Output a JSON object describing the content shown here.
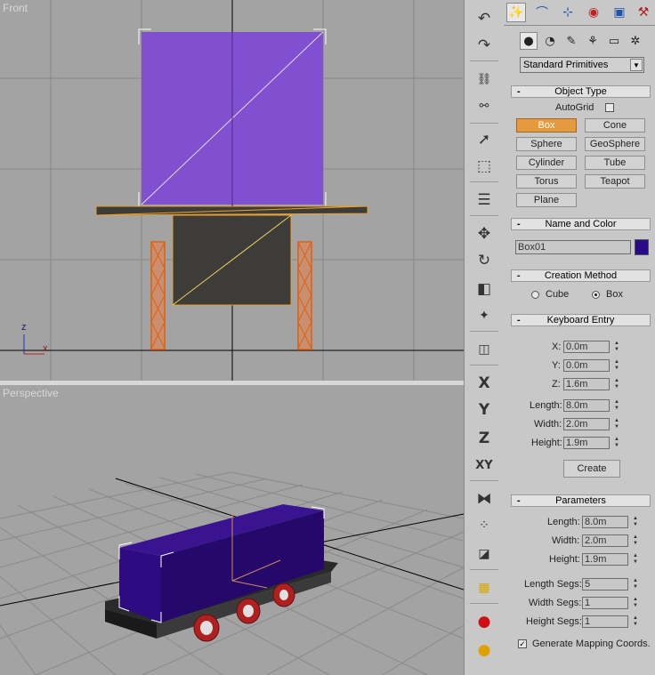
{
  "viewports": {
    "front_label": "Front",
    "perspective_label": "Perspective",
    "axis_z": "z",
    "axis_x": "x"
  },
  "toolbar": {
    "buttons": [
      "undo-icon",
      "redo-icon",
      "select-link-icon",
      "unlink-icon",
      "select-icon",
      "select-region-icon",
      "select-by-name-icon",
      "move-icon",
      "rotate-icon",
      "scale-icon",
      "pivot-icon",
      "mirror-icon",
      "X",
      "Y",
      "Z",
      "XY",
      "mirror-axis-icon",
      "array-icon",
      "align-icon",
      "layers-icon",
      "render-scene-icon",
      "material-editor-icon"
    ],
    "x_label": "X",
    "y_label": "Y",
    "z_label": "Z",
    "xy_label": "XY"
  },
  "command_panel": {
    "dropdown_value": "Standard Primitives",
    "object_type": {
      "title": "Object Type",
      "autogrid_label": "AutoGrid",
      "buttons": [
        "Box",
        "Cone",
        "Sphere",
        "GeoSphere",
        "Cylinder",
        "Tube",
        "Torus",
        "Teapot",
        "Plane"
      ],
      "active": "Box"
    },
    "name_color": {
      "title": "Name and Color",
      "name_value": "Box01",
      "color": "#2a0a8a"
    },
    "creation_method": {
      "title": "Creation Method",
      "option_cube": "Cube",
      "option_box": "Box",
      "selected": "Box"
    },
    "keyboard_entry": {
      "title": "Keyboard Entry",
      "x_label": "X:",
      "x_value": "0.0m",
      "y_label": "Y:",
      "y_value": "0.0m",
      "z_label": "Z:",
      "z_value": "1.6m",
      "length_label": "Length:",
      "length_value": "8.0m",
      "width_label": "Width:",
      "width_value": "2.0m",
      "height_label": "Height:",
      "height_value": "1.9m",
      "create_label": "Create"
    },
    "parameters": {
      "title": "Parameters",
      "length_label": "Length:",
      "length_value": "8.0m",
      "width_label": "Width:",
      "width_value": "2.0m",
      "height_label": "Height:",
      "height_value": "1.9m",
      "length_segs_label": "Length Segs:",
      "length_segs_value": "5",
      "width_segs_label": "Width Segs:",
      "width_segs_value": "1",
      "height_segs_label": "Height Segs:",
      "height_segs_value": "1",
      "mapping_label": "Generate Mapping Coords.",
      "mapping_checked": true
    }
  },
  "colors": {
    "box_front": "#8050d0",
    "box_persp": "#2a0a70",
    "active_button": "#e59a3e",
    "selection_orange": "#e8a030"
  }
}
